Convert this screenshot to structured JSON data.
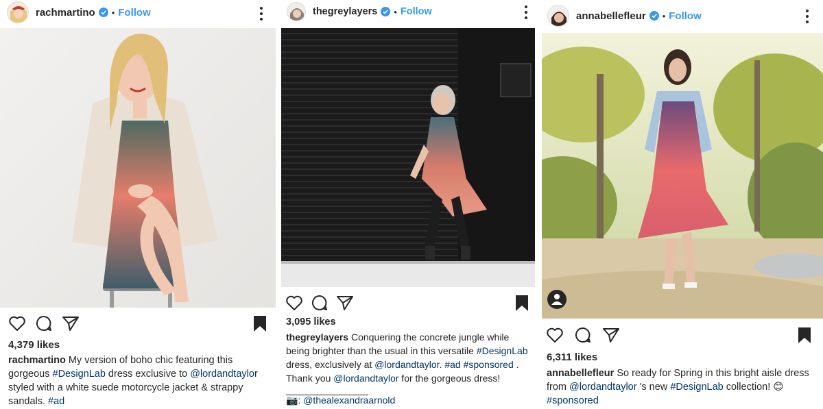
{
  "colors": {
    "link": "#003569",
    "follow": "#3897f0",
    "verified": "#3897f0",
    "text": "#262626"
  },
  "icons": [
    "heart-icon",
    "comment-icon",
    "share-icon",
    "bookmark-icon",
    "verified-badge-icon",
    "more-options-icon",
    "tagged-user-icon"
  ],
  "posts": [
    {
      "username": "rachmartino",
      "follow": "Follow",
      "dot": "•",
      "likes": "4,379 likes",
      "caption_user": "rachmartino",
      "caption_text_1": " My version of boho chic featuring this gorgeous ",
      "caption_tag_1": "#DesignLab",
      "caption_text_2": " dress exclusive to ",
      "caption_mention_1": "@lordandtaylor",
      "caption_text_3": " styled with a white suede motorcycle jacket & strappy sandals. ",
      "caption_tag_2": "#ad"
    },
    {
      "username": "thegreylayers",
      "follow": "Follow",
      "dot": "•",
      "likes": "3,095 likes",
      "caption_user": "thegreylayers",
      "caption_text_1": " Conquering the concrete jungle while being brighter than the usual in this versatile ",
      "caption_tag_1": "#DesignLab",
      "caption_text_2": " dress, exclusively at ",
      "caption_mention_1": "@lordandtaylor",
      "caption_text_3": ". ",
      "caption_tag_2": "#ad",
      "caption_text_4": " ",
      "caption_tag_3": "#sponsored",
      "caption_text_5": " . Thank you ",
      "caption_mention_2": "@lordandtaylor",
      "caption_text_6": " for the gorgeous dress! ",
      "credit_icon": "📷",
      "credit_colon": ": ",
      "credit_handle": "@thealexandraarnold"
    },
    {
      "username": "annabellefleur",
      "follow": "Follow",
      "dot": "•",
      "likes": "6,311 likes",
      "caption_user": "annabellefleur",
      "caption_text_1": " So ready for Spring in this bright aisle dress from ",
      "caption_mention_1": "@lordandtaylor",
      "caption_text_2": " 's new ",
      "caption_tag_1": "#DesignLab",
      "caption_text_3": " collection! ",
      "caption_emoji": "😊",
      "caption_text_4": " ",
      "caption_tag_2": "#sponsored"
    }
  ]
}
